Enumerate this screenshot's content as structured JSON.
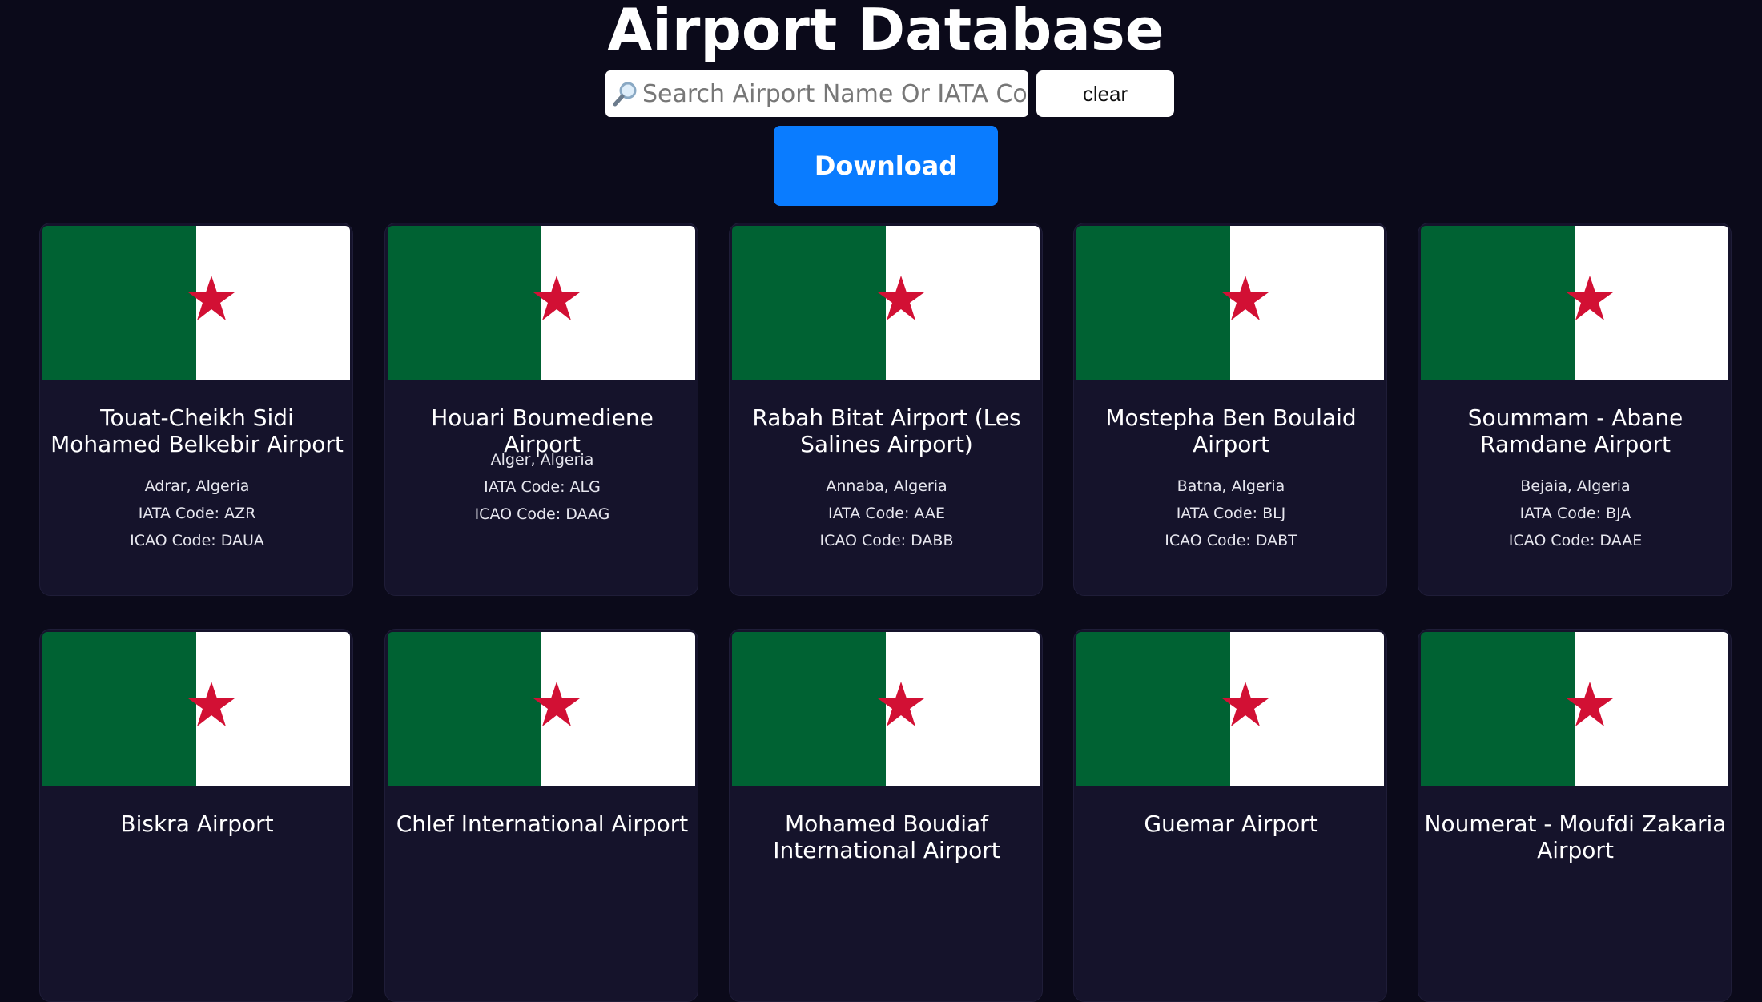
{
  "header": {
    "title": "Airport Database",
    "search_placeholder": "Search Airport Name Or IATA Code",
    "search_value": "",
    "search_icon": "magnifier-icon",
    "clear_label": "clear",
    "download_label": "Download"
  },
  "colors": {
    "background": "#0b0a1a",
    "card": "#15132b",
    "download_button": "#0a7cff",
    "flag_green": "#006233",
    "flag_white": "#ffffff",
    "flag_red": "#d21034"
  },
  "cards": [
    {
      "name": "Touat-Cheikh Sidi Mohamed Belkebir Airport",
      "location": "Adrar, Algeria",
      "iata": "IATA Code: AZR",
      "icao": "ICAO Code: DAUA",
      "flag": "algeria-flag"
    },
    {
      "name": "Houari Boumediene Airport",
      "location": "Alger, Algeria",
      "iata": "IATA Code: ALG",
      "icao": "ICAO Code: DAAG",
      "flag": "algeria-flag"
    },
    {
      "name": "Rabah Bitat Airport (Les Salines Airport)",
      "location": "Annaba, Algeria",
      "iata": "IATA Code: AAE",
      "icao": "ICAO Code: DABB",
      "flag": "algeria-flag"
    },
    {
      "name": "Mostepha Ben Boulaid Airport",
      "location": "Batna, Algeria",
      "iata": "IATA Code: BLJ",
      "icao": "ICAO Code: DABT",
      "flag": "algeria-flag"
    },
    {
      "name": "Soummam - Abane Ramdane Airport",
      "location": "Bejaia, Algeria",
      "iata": "IATA Code: BJA",
      "icao": "ICAO Code: DAAE",
      "flag": "algeria-flag"
    },
    {
      "name": "Biskra Airport",
      "flag": "algeria-flag"
    },
    {
      "name": "Chlef International Airport",
      "flag": "algeria-flag"
    },
    {
      "name": "Mohamed Boudiaf International Airport",
      "flag": "algeria-flag"
    },
    {
      "name": "Guemar Airport",
      "flag": "algeria-flag"
    },
    {
      "name": "Noumerat - Moufdi Zakaria Airport",
      "flag": "algeria-flag"
    }
  ]
}
